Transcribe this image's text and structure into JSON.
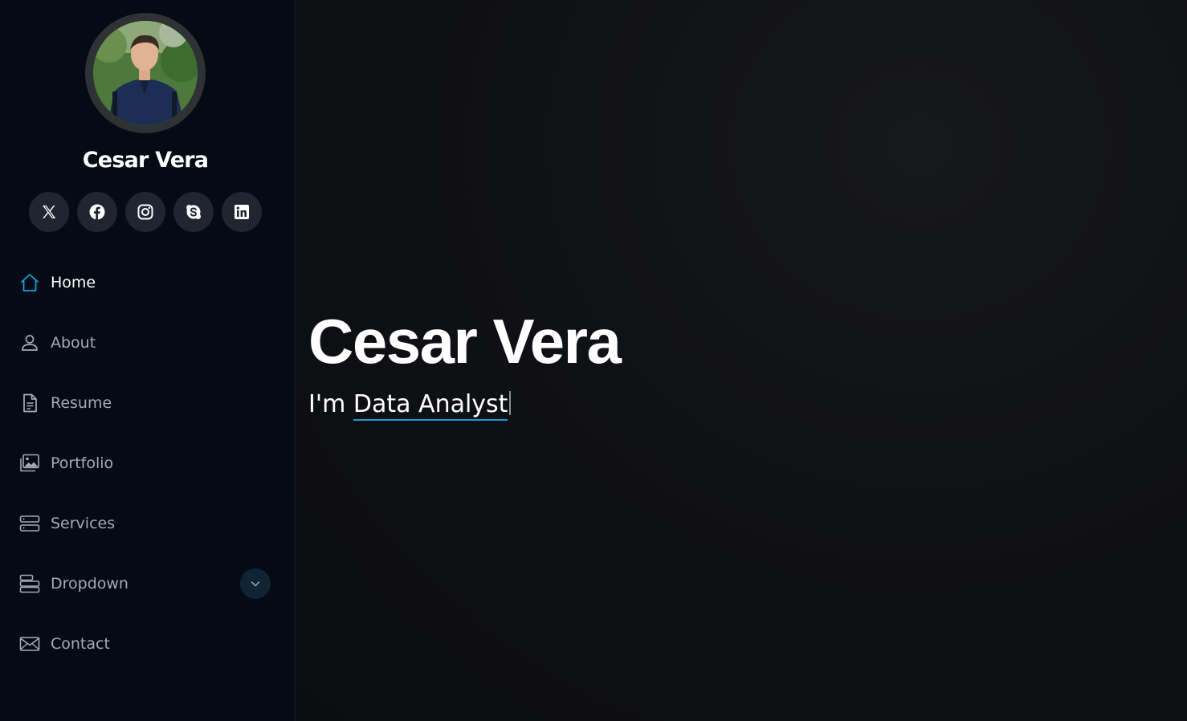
{
  "sidebar": {
    "profile_name": "Cesar Vera",
    "social": [
      {
        "icon": "x-twitter-icon"
      },
      {
        "icon": "facebook-icon"
      },
      {
        "icon": "instagram-icon"
      },
      {
        "icon": "skype-icon"
      },
      {
        "icon": "linkedin-icon"
      }
    ],
    "nav": [
      {
        "label": "Home",
        "icon": "home-icon",
        "active": true
      },
      {
        "label": "About",
        "icon": "person-icon"
      },
      {
        "label": "Resume",
        "icon": "document-icon"
      },
      {
        "label": "Portfolio",
        "icon": "images-icon"
      },
      {
        "label": "Services",
        "icon": "server-icon"
      },
      {
        "label": "Dropdown",
        "icon": "menu-icon",
        "has_toggle": true
      },
      {
        "label": "Contact",
        "icon": "envelope-icon"
      }
    ]
  },
  "hero": {
    "title": "Cesar Vera",
    "prefix": "I'm",
    "typed": "Data Analyst"
  },
  "colors": {
    "accent": "#149ddd",
    "sidebar_bg": "#040b14",
    "main_bg": "#0e0f13"
  }
}
